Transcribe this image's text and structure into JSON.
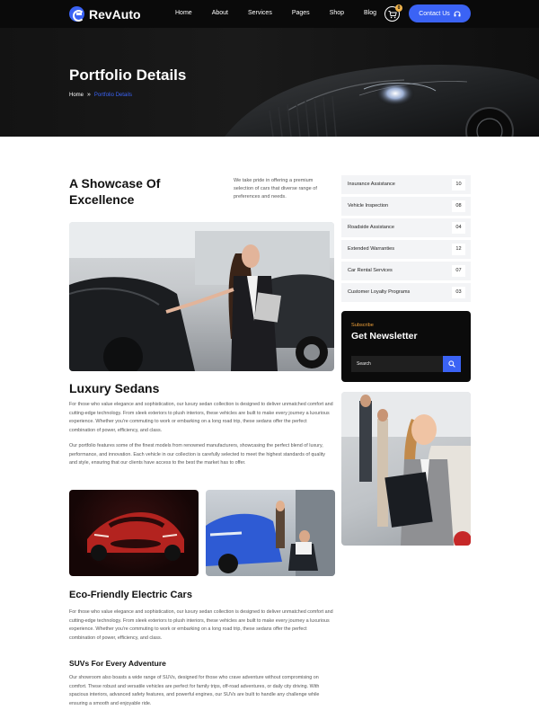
{
  "header": {
    "brand": "RevAuto",
    "nav": [
      "Home",
      "About",
      "Services",
      "Pages",
      "Shop",
      "Blog"
    ],
    "cart_count": "0",
    "contact_label": "Contact Us"
  },
  "hero": {
    "title": "Portfolio Details",
    "breadcrumb_home": "Home",
    "breadcrumb_current": "Portfolio Details"
  },
  "intro": {
    "title": "A Showcase Of Excellence",
    "text": "We take pride in offering a premium selection of cars that diverse range of preferences and needs."
  },
  "sections": {
    "luxury_title": "Luxury Sedans",
    "luxury_p1": "For those who value elegance and sophistication, our luxury sedan collection is designed to deliver unmatched comfort and cutting-edge technology. From sleek exteriors to plush interiors, these vehicles are built to make every journey a luxurious experience. Whether you're commuting to work or embarking on a long road trip, these sedans offer the perfect combination of power, efficiency, and class.",
    "luxury_p2": "Our portfolio features some of the finest models from renowned manufacturers, showcasing the perfect blend of luxury, performance, and innovation. Each vehicle in our collection is carefully selected to meet the highest standards of quality and style, ensuring that our clients have access to the best the market has to offer.",
    "eco_title": "Eco-Friendly Electric Cars",
    "eco_p1": "For those who value elegance and sophistication, our luxury sedan collection is designed to deliver unmatched comfort and cutting-edge technology. From sleek exteriors to plush interiors, these vehicles are built to make every journey a luxurious experience. Whether you're commuting to work or embarking on a long road trip, these sedans offer the perfect combination of power, efficiency, and class.",
    "suv_title": "SUVs For Every Adventure",
    "suv_p1": "Our showroom also boasts a wide range of SUVs, designed for those who crave adventure without compromising on comfort. These robust and versatile vehicles are perfect for family trips, off-road adventures, or daily city driving. With spacious interiors, advanced safety features, and powerful engines, our SUVs are built to handle any challenge while ensuring a smooth and enjoyable ride."
  },
  "services": [
    {
      "label": "Insurance Assistance",
      "count": "10"
    },
    {
      "label": "Vehicle Inspection",
      "count": "08"
    },
    {
      "label": "Roadside Assistance",
      "count": "04"
    },
    {
      "label": "Extended Warranties",
      "count": "12"
    },
    {
      "label": "Car Rental Services",
      "count": "07"
    },
    {
      "label": "Customer Loyalty Programs",
      "count": "03"
    }
  ],
  "newsletter": {
    "subtitle": "Subscribe",
    "title": "Get Newsletter",
    "placeholder": "Search"
  },
  "colors": {
    "accent": "#3b63f5",
    "orange": "#f1a23a",
    "dark": "#0a0a0a"
  }
}
